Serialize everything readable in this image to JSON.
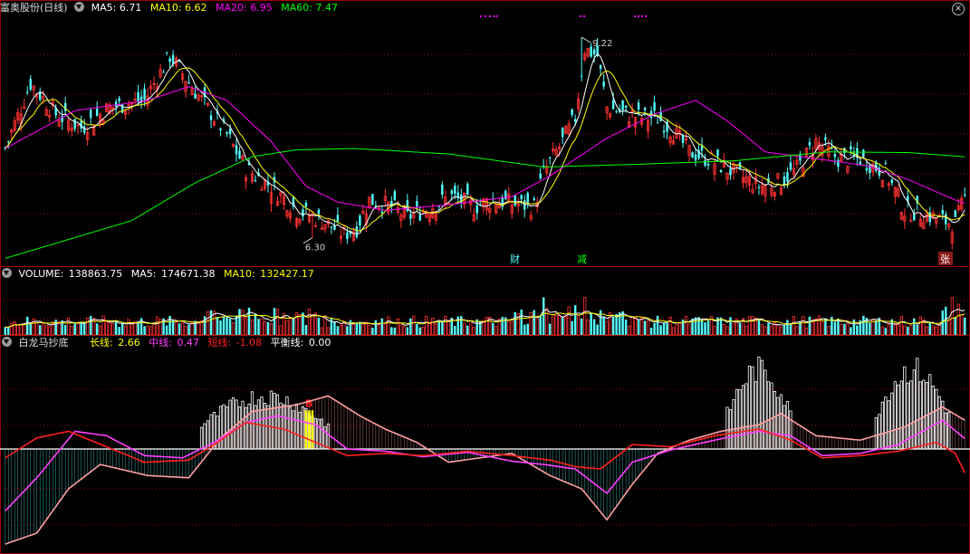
{
  "header_main": {
    "stock_name": "富奥股份(日线)",
    "ma5_label": "MA5:",
    "ma5_value": "6.71",
    "ma10_label": "MA10:",
    "ma10_value": "6.62",
    "ma20_label": "MA20:",
    "ma20_value": "6.95",
    "ma60_label": "MA60:",
    "ma60_value": "7.47"
  },
  "header_volume": {
    "label": "VOLUME:",
    "value": "138863.75",
    "ma5_label": "MA5:",
    "ma5_value": "174671.38",
    "ma10_label": "MA10:",
    "ma10_value": "132427.17"
  },
  "header_indicator": {
    "name": "白龙马抄底",
    "long_label": "长线:",
    "long_value": "2.66",
    "mid_label": "中线:",
    "mid_value": "0.47",
    "short_label": "短线:",
    "short_value": "-1.08",
    "balance_label": "平衡线:",
    "balance_value": "0.00"
  },
  "annotations": {
    "high_price": "9.22",
    "low_price": "6.30",
    "marker_cai": "财",
    "marker_jian": "减",
    "marker_zhang": "张",
    "buy_mark": "B"
  },
  "icons": {
    "collapse": "chevron-down-icon",
    "close": "close-icon"
  },
  "colors": {
    "up": "#ff3232",
    "down": "#54ffff",
    "ma5": "#ffffff",
    "ma10": "#ffff00",
    "ma20": "#ff00ff",
    "ma60": "#00ff00",
    "long_line": "#ff9ea0",
    "mid_line": "#ff40ff",
    "short_line": "#ff2020",
    "balance_line": "#ffffff",
    "grid": "#a00000",
    "buy_bar": "#ffff00"
  },
  "chart_data": {
    "type": "candlestick",
    "price_range": [
      5.9,
      9.55
    ],
    "volume_range": [
      0,
      300000
    ],
    "indicator_range": [
      -4.5,
      4.5
    ],
    "series_price_anchors": [
      [
        0,
        7.6
      ],
      [
        8,
        8.55
      ],
      [
        16,
        8.1
      ],
      [
        24,
        7.9
      ],
      [
        33,
        8.2
      ],
      [
        44,
        8.3
      ],
      [
        52,
        8.95
      ],
      [
        62,
        8.3
      ],
      [
        70,
        7.8
      ],
      [
        76,
        7.3
      ],
      [
        84,
        7.05
      ],
      [
        92,
        6.7
      ],
      [
        100,
        6.55
      ],
      [
        107,
        6.35
      ],
      [
        111,
        6.45
      ],
      [
        115,
        6.85
      ],
      [
        122,
        6.75
      ],
      [
        127,
        6.6
      ],
      [
        133,
        6.72
      ],
      [
        141,
        6.9
      ],
      [
        148,
        6.75
      ],
      [
        154,
        6.85
      ],
      [
        160,
        6.8
      ],
      [
        167,
        6.75
      ],
      [
        170,
        7.25
      ],
      [
        176,
        7.7
      ],
      [
        180,
        8.05
      ],
      [
        183,
        9.05
      ],
      [
        187,
        8.95
      ],
      [
        190,
        8.2
      ],
      [
        196,
        8.1
      ],
      [
        201,
        8.05
      ],
      [
        206,
        8.05
      ],
      [
        211,
        7.85
      ],
      [
        216,
        7.55
      ],
      [
        222,
        7.45
      ],
      [
        230,
        7.25
      ],
      [
        238,
        7.05
      ],
      [
        244,
        7.1
      ],
      [
        250,
        7.3
      ],
      [
        256,
        7.7
      ],
      [
        263,
        7.45
      ],
      [
        270,
        7.45
      ],
      [
        278,
        7.25
      ],
      [
        284,
        6.7
      ],
      [
        290,
        6.65
      ],
      [
        296,
        6.55
      ],
      [
        300,
        6.5
      ],
      [
        303,
        6.88
      ]
    ],
    "ma60_anchors": [
      [
        0,
        6.0
      ],
      [
        40,
        6.55
      ],
      [
        60,
        7.1
      ],
      [
        78,
        7.48
      ],
      [
        92,
        7.58
      ],
      [
        110,
        7.6
      ],
      [
        140,
        7.52
      ],
      [
        170,
        7.33
      ],
      [
        200,
        7.37
      ],
      [
        230,
        7.42
      ],
      [
        260,
        7.55
      ],
      [
        285,
        7.54
      ],
      [
        303,
        7.48
      ]
    ],
    "ma20_anchors": [
      [
        0,
        7.6
      ],
      [
        10,
        7.85
      ],
      [
        22,
        8.15
      ],
      [
        45,
        8.3
      ],
      [
        58,
        8.5
      ],
      [
        70,
        8.3
      ],
      [
        84,
        7.7
      ],
      [
        95,
        7.05
      ],
      [
        105,
        6.82
      ],
      [
        120,
        6.7
      ],
      [
        140,
        6.78
      ],
      [
        160,
        6.9
      ],
      [
        172,
        7.2
      ],
      [
        190,
        7.75
      ],
      [
        205,
        8.1
      ],
      [
        218,
        8.3
      ],
      [
        228,
        8.0
      ],
      [
        240,
        7.55
      ],
      [
        256,
        7.45
      ],
      [
        272,
        7.35
      ],
      [
        285,
        7.15
      ],
      [
        300,
        6.85
      ],
      [
        303,
        6.8
      ]
    ],
    "indicator_long_anchors": [
      [
        0,
        -4.3
      ],
      [
        10,
        -3.8
      ],
      [
        20,
        -1.8
      ],
      [
        30,
        -0.7
      ],
      [
        45,
        -1.2
      ],
      [
        58,
        -1.3
      ],
      [
        68,
        0.5
      ],
      [
        78,
        1.7
      ],
      [
        92,
        2.0
      ],
      [
        102,
        2.4
      ],
      [
        112,
        1.5
      ],
      [
        120,
        0.9
      ],
      [
        130,
        0.3
      ],
      [
        140,
        -0.6
      ],
      [
        150,
        -0.4
      ],
      [
        160,
        -0.2
      ],
      [
        172,
        -1.2
      ],
      [
        182,
        -1.8
      ],
      [
        190,
        -3.2
      ],
      [
        198,
        -1.6
      ],
      [
        206,
        -0.2
      ],
      [
        216,
        0.4
      ],
      [
        226,
        0.8
      ],
      [
        238,
        1.1
      ],
      [
        245,
        1.6
      ],
      [
        256,
        0.6
      ],
      [
        270,
        0.4
      ],
      [
        284,
        1.0
      ],
      [
        296,
        1.9
      ],
      [
        303,
        1.3
      ]
    ],
    "indicator_mid_anchors": [
      [
        0,
        -2.8
      ],
      [
        10,
        -1.3
      ],
      [
        22,
        0.8
      ],
      [
        32,
        0.6
      ],
      [
        44,
        -0.3
      ],
      [
        56,
        -0.4
      ],
      [
        66,
        0.3
      ],
      [
        76,
        1.2
      ],
      [
        86,
        1.5
      ],
      [
        98,
        1.1
      ],
      [
        108,
        0.0
      ],
      [
        120,
        -0.1
      ],
      [
        132,
        -0.35
      ],
      [
        146,
        -0.15
      ],
      [
        160,
        -0.55
      ],
      [
        170,
        -0.7
      ],
      [
        180,
        -0.9
      ],
      [
        190,
        -2.0
      ],
      [
        198,
        -0.6
      ],
      [
        210,
        -0.05
      ],
      [
        224,
        0.4
      ],
      [
        238,
        0.8
      ],
      [
        248,
        0.6
      ],
      [
        258,
        -0.3
      ],
      [
        270,
        -0.2
      ],
      [
        282,
        0.2
      ],
      [
        296,
        1.3
      ],
      [
        303,
        0.47
      ]
    ],
    "indicator_short_anchors": [
      [
        0,
        -0.4
      ],
      [
        10,
        0.5
      ],
      [
        20,
        0.8
      ],
      [
        32,
        0.1
      ],
      [
        44,
        -0.6
      ],
      [
        58,
        -0.5
      ],
      [
        66,
        0.2
      ],
      [
        76,
        1.2
      ],
      [
        88,
        0.9
      ],
      [
        98,
        0.3
      ],
      [
        108,
        -0.3
      ],
      [
        120,
        -0.2
      ],
      [
        132,
        -0.3
      ],
      [
        146,
        -0.1
      ],
      [
        160,
        -0.3
      ],
      [
        172,
        -0.5
      ],
      [
        180,
        -0.8
      ],
      [
        188,
        -0.9
      ],
      [
        198,
        0.2
      ],
      [
        210,
        0.1
      ],
      [
        224,
        0.6
      ],
      [
        238,
        0.9
      ],
      [
        248,
        0.4
      ],
      [
        258,
        -0.4
      ],
      [
        270,
        -0.3
      ],
      [
        282,
        -0.1
      ],
      [
        294,
        0.3
      ],
      [
        300,
        -0.2
      ],
      [
        303,
        -1.08
      ]
    ],
    "white_bar_zones": [
      [
        62,
        102,
        2.8
      ],
      [
        228,
        248,
        4.2
      ],
      [
        275,
        298,
        4.2
      ]
    ],
    "buy_bars_index": [
      95,
      96,
      97
    ],
    "high_index": 182,
    "low_index": 97
  }
}
